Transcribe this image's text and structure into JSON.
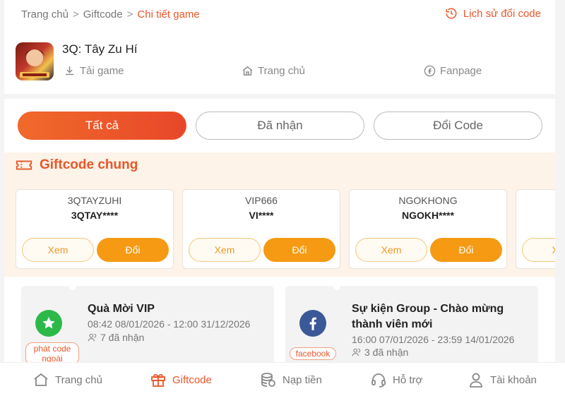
{
  "breadcrumb": {
    "home": "Trang chủ",
    "giftcode": "Giftcode",
    "current": "Chi tiết game",
    "separator": ">"
  },
  "history_label": "Lịch sử đổi code",
  "game": {
    "title": "3Q: Tây Zu Hí",
    "links": {
      "download": "Tải game",
      "home": "Trang chủ",
      "fanpage": "Fanpage"
    }
  },
  "tabs": [
    {
      "label": "Tất cả",
      "active": true
    },
    {
      "label": "Đã nhận",
      "active": false
    },
    {
      "label": "Đổi Code",
      "active": false
    }
  ],
  "gift_section": {
    "title": "Giftcode chung",
    "cards": [
      {
        "name": "3QTAYZUHI",
        "code": "3QTAY****",
        "view": "Xem",
        "swap": "Đổi"
      },
      {
        "name": "VIP666",
        "code": "VI****",
        "view": "Xem",
        "swap": "Đổi"
      },
      {
        "name": "NGOKHONG",
        "code": "NGOKH****",
        "view": "Xem",
        "swap": "Đổi"
      },
      {
        "name": "",
        "code": "",
        "view": "Xe",
        "swap": ""
      }
    ]
  },
  "events": [
    {
      "title": "Quà Mời VIP",
      "time": "08:42 08/01/2026 - 12:00 31/12/2026",
      "claimed": "7 đã nhận",
      "tag": "phát code ngoài",
      "icon": "star-icon"
    },
    {
      "title": "Sự kiện Group - Chào mừng thành viên mới",
      "time": "16:00 07/01/2026 - 23:59 14/01/2026",
      "claimed": "3 đã nhận",
      "tag": "facebook",
      "icon": "facebook-icon"
    }
  ],
  "nav": [
    {
      "label": "Trang chủ",
      "icon": "home-icon",
      "active": false
    },
    {
      "label": "Giftcode",
      "icon": "gift-icon",
      "active": true
    },
    {
      "label": "Nạp tiền",
      "icon": "coins-icon",
      "active": false
    },
    {
      "label": "Hỗ trợ",
      "icon": "headset-icon",
      "active": false
    },
    {
      "label": "Tài khoản",
      "icon": "user-icon",
      "active": false
    }
  ],
  "colors": {
    "accent": "#e8572a",
    "orange_button": "#f59a12",
    "section_bg": "#fdf3e8",
    "star_green": "#2db84a",
    "facebook_blue": "#3b5998"
  }
}
